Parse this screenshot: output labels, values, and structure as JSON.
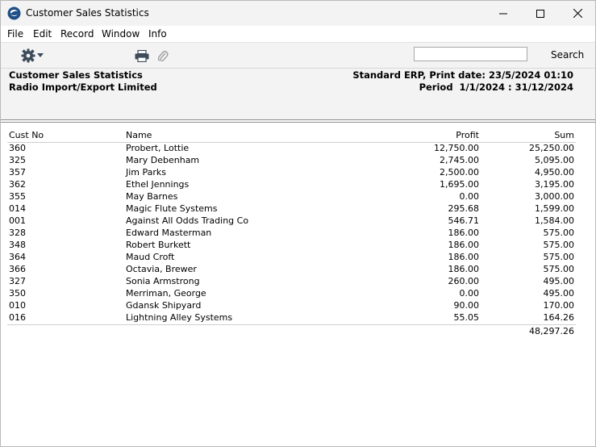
{
  "window": {
    "title": "Customer Sales Statistics"
  },
  "menu": {
    "items": [
      "File",
      "Edit",
      "Record",
      "Window",
      "Info"
    ]
  },
  "toolbar": {
    "search_label": "Search",
    "search_value": ""
  },
  "report": {
    "title": "Customer Sales Statistics",
    "company": "Radio Import/Export Limited",
    "print_info": "Standard ERP, Print date: 23/5/2024 01:10",
    "period": "Period  1/1/2024 : 31/12/2024"
  },
  "table": {
    "headers": {
      "cust_no": "Cust No",
      "name": "Name",
      "profit": "Profit",
      "sum": "Sum"
    },
    "rows": [
      {
        "cust_no": "360",
        "name": "Probert, Lottie",
        "profit": "12,750.00",
        "sum": "25,250.00"
      },
      {
        "cust_no": "325",
        "name": "Mary Debenham",
        "profit": "2,745.00",
        "sum": "5,095.00"
      },
      {
        "cust_no": "357",
        "name": "Jim Parks",
        "profit": "2,500.00",
        "sum": "4,950.00"
      },
      {
        "cust_no": "362",
        "name": "Ethel Jennings",
        "profit": "1,695.00",
        "sum": "3,195.00"
      },
      {
        "cust_no": "355",
        "name": "May Barnes",
        "profit": "0.00",
        "sum": "3,000.00"
      },
      {
        "cust_no": "014",
        "name": "Magic Flute Systems",
        "profit": "295.68",
        "sum": "1,599.00"
      },
      {
        "cust_no": "001",
        "name": "Against All Odds Trading Co",
        "profit": "546.71",
        "sum": "1,584.00"
      },
      {
        "cust_no": "328",
        "name": "Edward Masterman",
        "profit": "186.00",
        "sum": "575.00"
      },
      {
        "cust_no": "348",
        "name": "Robert Burkett",
        "profit": "186.00",
        "sum": "575.00"
      },
      {
        "cust_no": "364",
        "name": "Maud Croft",
        "profit": "186.00",
        "sum": "575.00"
      },
      {
        "cust_no": "366",
        "name": "Octavia, Brewer",
        "profit": "186.00",
        "sum": "575.00"
      },
      {
        "cust_no": "327",
        "name": "Sonia Armstrong",
        "profit": "260.00",
        "sum": "495.00"
      },
      {
        "cust_no": "350",
        "name": "Merriman, George",
        "profit": "0.00",
        "sum": "495.00"
      },
      {
        "cust_no": "010",
        "name": "Gdansk Shipyard",
        "profit": "90.00",
        "sum": "170.00"
      },
      {
        "cust_no": "016",
        "name": "Lightning Alley Systems",
        "profit": "55.05",
        "sum": "164.26"
      }
    ],
    "total_sum": "48,297.26"
  }
}
